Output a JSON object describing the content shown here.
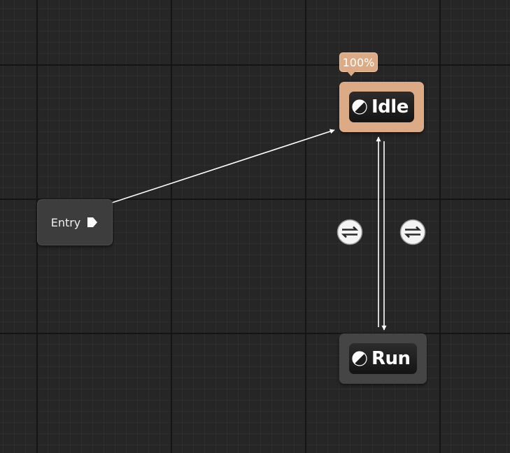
{
  "graph": {
    "entry_node": {
      "label": "Entry"
    },
    "states": [
      {
        "id": "idle",
        "label": "Idle",
        "weight_badge": "100%",
        "active": true
      },
      {
        "id": "run",
        "label": "Run",
        "active": false
      }
    ],
    "transitions": [
      {
        "from": "Entry",
        "to": "Idle",
        "icon": "arrow-icon"
      },
      {
        "from": "Idle",
        "to": "Run",
        "icon": "transition-rule-icon"
      },
      {
        "from": "Run",
        "to": "Idle",
        "icon": "transition-rule-icon"
      }
    ]
  },
  "colors": {
    "canvas_background": "#262626",
    "active_state": "#dcab85",
    "inactive_state": "#454545",
    "wire": "#ffffff"
  }
}
